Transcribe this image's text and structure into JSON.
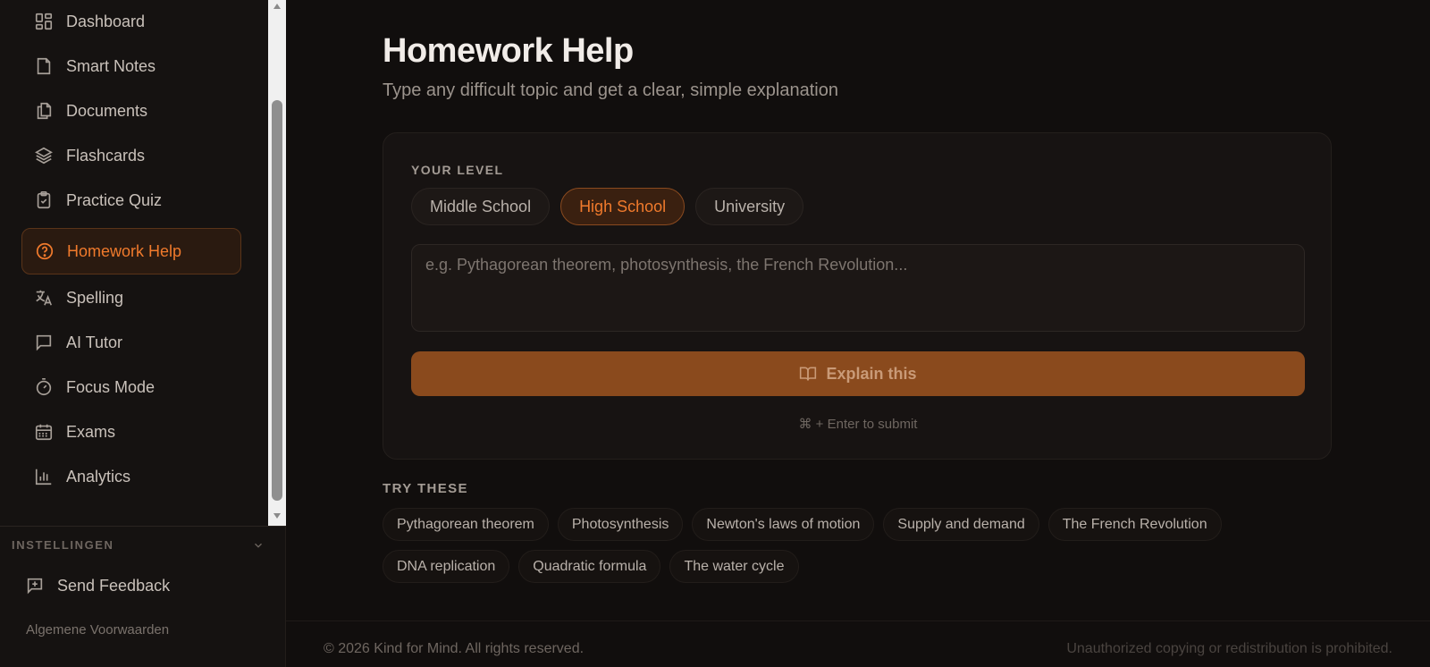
{
  "sidebar": {
    "items": [
      {
        "label": "Dashboard",
        "icon": "dashboard-icon"
      },
      {
        "label": "Smart Notes",
        "icon": "note-icon"
      },
      {
        "label": "Documents",
        "icon": "documents-icon"
      },
      {
        "label": "Flashcards",
        "icon": "layers-icon"
      },
      {
        "label": "Practice Quiz",
        "icon": "clipboard-check-icon"
      },
      {
        "label": "Homework Help",
        "icon": "help-circle-icon",
        "active": true
      },
      {
        "label": "Spelling",
        "icon": "translate-icon"
      },
      {
        "label": "AI Tutor",
        "icon": "chat-icon"
      },
      {
        "label": "Focus Mode",
        "icon": "timer-icon"
      },
      {
        "label": "Exams",
        "icon": "calendar-icon"
      },
      {
        "label": "Analytics",
        "icon": "bar-chart-icon"
      }
    ],
    "settings_label": "INSTELLINGEN",
    "feedback_label": "Send Feedback",
    "terms_label": "Algemene Voorwaarden"
  },
  "main": {
    "title": "Homework Help",
    "subtitle": "Type any difficult topic and get a clear, simple explanation",
    "level_label": "YOUR LEVEL",
    "levels": [
      {
        "label": "Middle School",
        "selected": false
      },
      {
        "label": "High School",
        "selected": true
      },
      {
        "label": "University",
        "selected": false
      }
    ],
    "topic_placeholder": "e.g. Pythagorean theorem, photosynthesis, the French Revolution...",
    "topic_value": "",
    "explain_label": "Explain this",
    "submit_hint": "⌘ + Enter to submit",
    "try_label": "TRY THESE",
    "suggestions": [
      [
        "Pythagorean theorem",
        "Photosynthesis",
        "Newton's laws of motion",
        "Supply and demand",
        "The French Revolution"
      ],
      [
        "DNA replication",
        "Quadratic formula",
        "The water cycle"
      ]
    ]
  },
  "footer": {
    "copyright": "© 2026 Kind for Mind. All rights reserved.",
    "legal": "Unauthorized copying or redistribution is prohibited."
  },
  "colors": {
    "accent": "#f07a2c",
    "button_bg": "#8a4a1d",
    "background": "#110e0d",
    "sidebar_bg": "#151211"
  }
}
